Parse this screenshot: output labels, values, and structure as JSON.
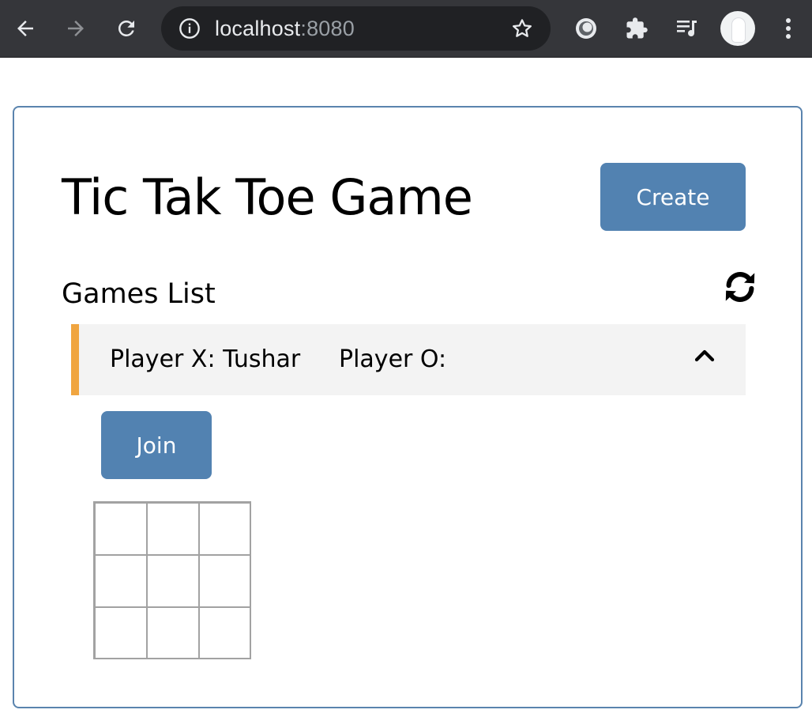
{
  "browser": {
    "url_host": "localhost",
    "url_port": ":8080",
    "icons": [
      "back-arrow-icon",
      "forward-arrow-icon",
      "reload-icon",
      "info-icon",
      "star-icon",
      "extension-icon",
      "puzzle-icon",
      "media-queue-icon",
      "avatar",
      "kebab-menu-icon"
    ],
    "colors": {
      "toolbar": "#35363a",
      "omnibox": "#202124"
    }
  },
  "page": {
    "title": "Tic Tak Toe Game",
    "create_label": "Create",
    "games_list_label": "Games List",
    "colors": {
      "button": "#5282b1",
      "card_border": "#5a84ae",
      "row_accent": "#f0a540",
      "row_bg": "#f3f3f3"
    }
  },
  "games": [
    {
      "player_x": "Player X: Tushar",
      "player_o": "Player O:",
      "join_label": "Join",
      "board": [
        "",
        "",
        "",
        "",
        "",
        "",
        "",
        "",
        ""
      ]
    }
  ]
}
